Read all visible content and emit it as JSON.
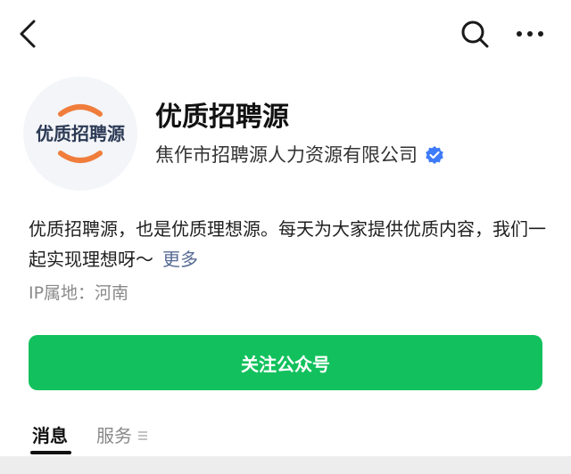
{
  "account": {
    "avatar_text": "优质招聘源",
    "name": "优质招聘源",
    "organization": "焦作市招聘源人力资源有限公司",
    "description": "优质招聘源，也是优质理想源。每天为大家提供优质内容，我们一起实现理想呀～",
    "more_label": "更多",
    "ip_location": "IP属地：河南"
  },
  "actions": {
    "follow_label": "关注公众号"
  },
  "tabs": [
    {
      "label": "消息",
      "active": true
    },
    {
      "label": "服务",
      "active": false
    }
  ],
  "icons": {
    "back": "chevron-left-icon",
    "search": "search-icon",
    "more": "more-dots-icon",
    "verified": "verified-badge-icon",
    "menu": "menu-lines-icon"
  },
  "colors": {
    "primary_green": "#12c15d",
    "link_blue": "#576b95",
    "verified_blue": "#3e7bfa",
    "avatar_accent": "#f07d3c"
  }
}
